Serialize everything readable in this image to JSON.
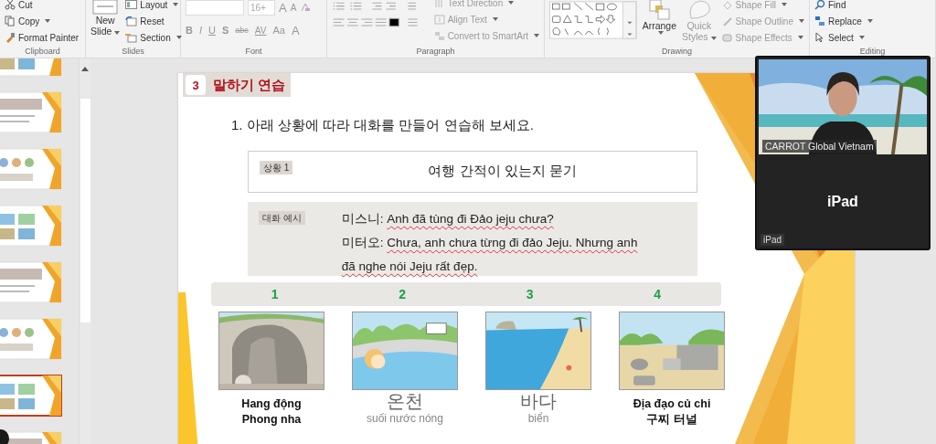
{
  "ribbon": {
    "clipboard": {
      "label": "Clipboard",
      "cut": "Cut",
      "copy": "Copy",
      "format_painter": "Format Painter"
    },
    "slides": {
      "label": "Slides",
      "new_slide": [
        "New",
        "Slide"
      ],
      "layout": "Layout",
      "reset": "Reset",
      "section": "Section"
    },
    "font": {
      "label": "Font",
      "size": "16+",
      "grow": "A",
      "shrink": "A",
      "styles": [
        "B",
        "I",
        "U",
        "S",
        "abc",
        "AV",
        "Aa",
        "A"
      ]
    },
    "paragraph": {
      "label": "Paragraph",
      "text_direction": "Text Direction",
      "align_text": "Align Text",
      "convert": "Convert to SmartArt"
    },
    "drawing": {
      "label": "Drawing",
      "arrange": "Arrange",
      "quick_styles": [
        "Quick",
        "Styles"
      ],
      "shape_fill": "Shape Fill",
      "shape_outline": "Shape Outline",
      "shape_effects": "Shape Effects"
    },
    "editing": {
      "label": "Editing",
      "find": "Find",
      "replace": "Replace",
      "select": "Select"
    }
  },
  "thumbnails": [
    {
      "selected": false
    },
    {
      "selected": false
    },
    {
      "selected": false
    },
    {
      "selected": false
    },
    {
      "selected": false
    },
    {
      "selected": false
    },
    {
      "selected": true
    },
    {
      "selected": false
    }
  ],
  "slide": {
    "section_number": "3",
    "section_title": "말하기 연습",
    "instruction": "1. 아래 상황에 따라 대화를 만들어 연습해 보세요.",
    "situation": {
      "tag": "상황 1",
      "text": "여행 간적이 있는지 묻기"
    },
    "dialogue": {
      "tag": "대화 예시",
      "lines": [
        {
          "speaker": "미스니:",
          "text": "Anh đã tùng đi Đảo jeju chưa?"
        },
        {
          "speaker": "미터오:",
          "text": "Chưa, anh chưa từng đi đảo Jeju. Nhưng anh đã nghe nói Jeju rất đẹp."
        }
      ]
    },
    "items": [
      {
        "number": "1",
        "kind": "bold",
        "lines": [
          "Hang động",
          "Phong nha"
        ]
      },
      {
        "number": "2",
        "kind": "word",
        "word": "온천",
        "meaning": "suối nước nóng"
      },
      {
        "number": "3",
        "kind": "word",
        "word": "바다",
        "meaning": "biển"
      },
      {
        "number": "4",
        "kind": "bold",
        "lines": [
          "Địa đạo củ chi",
          "구찌 터널"
        ]
      }
    ]
  },
  "video": {
    "participant": "CARROT Global Vietnam",
    "device_title": "iPad",
    "device_label": "iPad"
  }
}
